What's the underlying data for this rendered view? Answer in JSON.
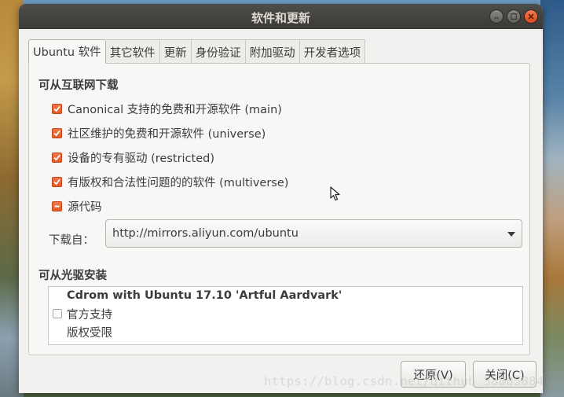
{
  "window": {
    "title": "软件和更新",
    "buttons": {
      "minimize": "minimize-icon",
      "maximize": "maximize-icon",
      "close": "close-icon"
    }
  },
  "tabs": [
    {
      "label": "Ubuntu 软件",
      "active": true
    },
    {
      "label": "其它软件",
      "active": false
    },
    {
      "label": "更新",
      "active": false
    },
    {
      "label": "身份验证",
      "active": false
    },
    {
      "label": "附加驱动",
      "active": false
    },
    {
      "label": "开发者选项",
      "active": false
    }
  ],
  "download": {
    "section_title": "可从互联网下载",
    "options": [
      {
        "label": "Canonical 支持的免费和开源软件 (main)",
        "state": "checked"
      },
      {
        "label": "社区维护的免费和开源软件 (universe)",
        "state": "checked"
      },
      {
        "label": "设备的专有驱动 (restricted)",
        "state": "checked"
      },
      {
        "label": "有版权和合法性问题的的软件 (multiverse)",
        "state": "checked"
      },
      {
        "label": "源代码",
        "state": "indeterminate"
      }
    ],
    "source_label": "下载自：",
    "source_value": "http://mirrors.aliyun.com/ubuntu"
  },
  "cdrom": {
    "section_title": "可从光驱安装",
    "name": "Cdrom with Ubuntu 17.10 'Artful Aardvark'",
    "line1": "官方支持",
    "line2": "版权受限",
    "checked": false
  },
  "footer": {
    "revert_label": "还原(V)",
    "close_label": "关闭(C)"
  },
  "watermark": "https://blog.csdn.net/github_38885884",
  "colors": {
    "accent": "#e95420",
    "titlebar": "#3b3a37",
    "window_bg": "#f2f1f0"
  }
}
